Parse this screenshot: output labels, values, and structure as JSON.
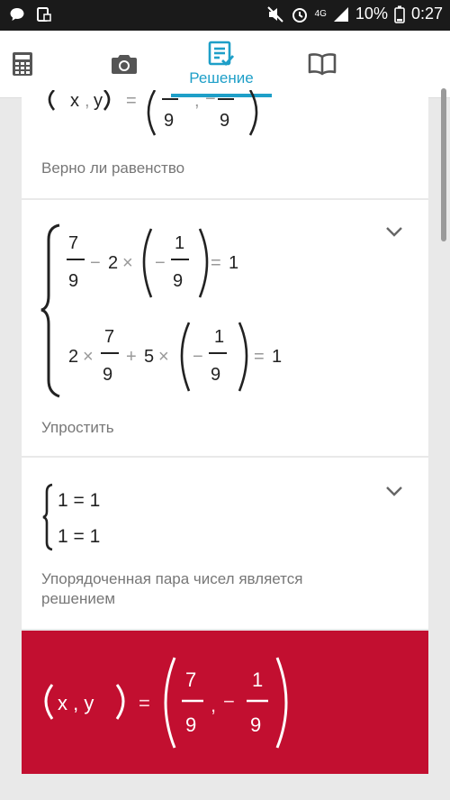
{
  "status_bar": {
    "network": "4G",
    "battery": "10%",
    "time": "0:27",
    "icons": [
      "chat-icon",
      "screen-rotate-icon",
      "mute-icon",
      "alarm-icon",
      "signal-icon",
      "battery-icon"
    ]
  },
  "toolbar": {
    "tabs": [
      {
        "icon": "calculator-icon",
        "label": ""
      },
      {
        "icon": "camera-icon",
        "label": ""
      },
      {
        "icon": "solution-icon",
        "label": "Решение",
        "active": true
      },
      {
        "icon": "book-icon",
        "label": ""
      }
    ],
    "accent_color": "#1e9fc8"
  },
  "steps": [
    {
      "expression": {
        "lhs": "(x , y)",
        "eq": "=",
        "rhs_visible": "(— , — )",
        "denominators": [
          "9",
          "9"
        ]
      },
      "caption": "Верно ли равенство"
    },
    {
      "system": [
        {
          "a": "7",
          "b": "9",
          "t1": "− 2 ×",
          "c": "1",
          "d": "9",
          "result": "1"
        },
        {
          "pre": "2 ×",
          "a": "7",
          "b": "9",
          "t1": "+ 5 ×",
          "c": "1",
          "d": "9",
          "result": "1"
        }
      ],
      "caption": "Упростить"
    },
    {
      "system": [
        "1 = 1",
        "1 = 1"
      ],
      "caption_lines": [
        "Упорядоченная пара чисел является",
        "решением"
      ]
    }
  ],
  "answer": {
    "lhs": "x , y",
    "eq": "=",
    "x_num": "7",
    "x_den": "9",
    "y_num": "1",
    "y_den": "9",
    "minus": "−",
    "background": "#c20f30"
  }
}
